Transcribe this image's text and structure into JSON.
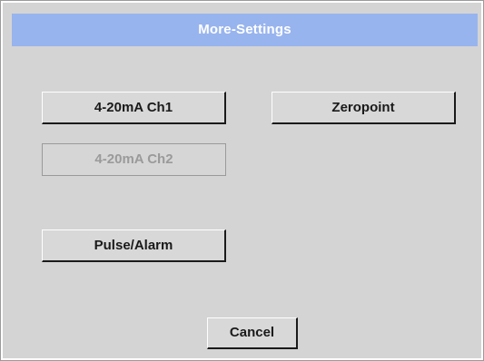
{
  "dialog": {
    "title": "More-Settings"
  },
  "buttons": {
    "ch1": "4-20mA Ch1",
    "zeropoint": "Zeropoint",
    "ch2": "4-20mA Ch2",
    "pulse_alarm": "Pulse/Alarm",
    "cancel": "Cancel"
  },
  "colors": {
    "title_bar": "#98b4ee",
    "panel_background": "#d4d4d4",
    "disabled_text": "#9a9a9a"
  }
}
